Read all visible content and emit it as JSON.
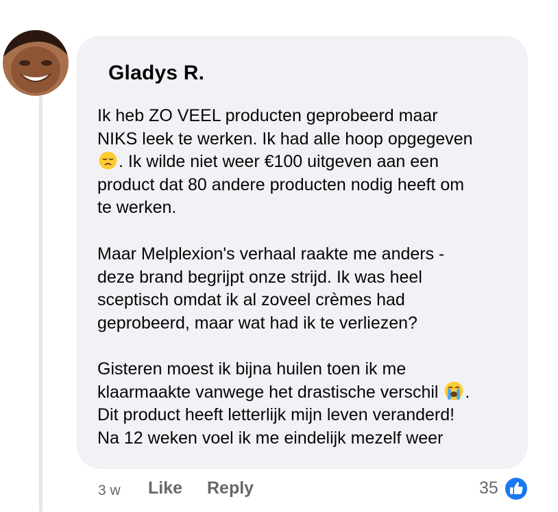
{
  "comment": {
    "author": "Gladys R.",
    "avatar_icon": "person-avatar",
    "paragraphs": [
      {
        "lines": [
          "Ik heb ZO VEEL producten geprobeerd maar",
          "NIKS leek te werken. Ik had alle hoop opgegeven",
          ". Ik wilde niet weer €100 uitgeven aan een",
          "product dat 80 andere producten nodig heeft om",
          "te werken."
        ]
      },
      {
        "lines": [
          "Maar Melplexion's verhaal raakte me anders -",
          "deze brand begrijpt onze strijd. Ik was heel",
          "sceptisch omdat ik al zoveel crèmes had",
          "geprobeerd, maar wat had ik te verliezen?"
        ]
      },
      {
        "lines": [
          "Gisteren moest ik bijna huilen toen ik me",
          "klaarmaakte vanwege het drastische verschil",
          "Dit product heeft letterlijk mijn leven veranderd!",
          "Na 12 weken voel ik me eindelijk mezelf weer"
        ]
      }
    ],
    "emojis": {
      "disappointed": "disappointed-face-emoji",
      "crying": "loudly-crying-face-emoji",
      "after_crying": "."
    },
    "footer": {
      "timestamp": "3 w",
      "like_label": "Like",
      "reply_label": "Reply",
      "reaction_count": "35",
      "reaction_icon": "thumbs-up-icon"
    }
  },
  "colors": {
    "bubble": "#f0f2f5",
    "text": "#050505",
    "secondary_text": "#65676b",
    "like_blue": "#1877f2"
  }
}
